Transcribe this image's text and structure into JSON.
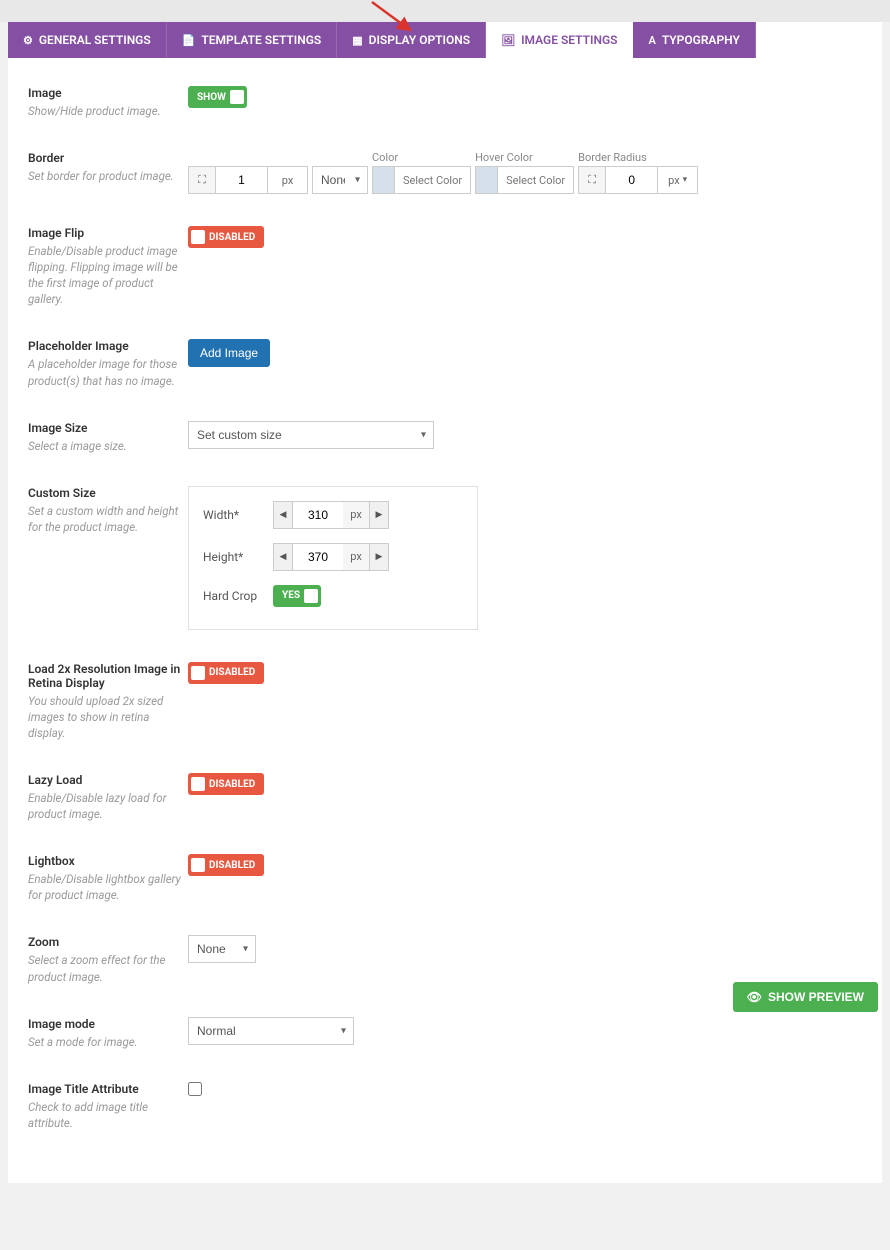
{
  "tabs": {
    "general": "GENERAL SETTINGS",
    "template": "TEMPLATE SETTINGS",
    "display": "DISPLAY OPTIONS",
    "image": "IMAGE SETTINGS",
    "typography": "TYPOGRAPHY"
  },
  "toggle": {
    "show": "SHOW",
    "disabled": "DISABLED",
    "yes": "YES"
  },
  "fields": {
    "image": {
      "label": "Image",
      "help": "Show/Hide product image."
    },
    "border": {
      "label": "Border",
      "help": "Set border for product image.",
      "width_val": "1",
      "width_unit": "px",
      "style": "None",
      "color_label": "Color",
      "color_btn": "Select Color",
      "hover_label": "Hover Color",
      "hover_btn": "Select Color",
      "radius_label": "Border Radius",
      "radius_val": "0",
      "radius_unit": "px"
    },
    "flip": {
      "label": "Image Flip",
      "help": "Enable/Disable product image flipping. Flipping image will be the first image of product gallery."
    },
    "placeholder": {
      "label": "Placeholder Image",
      "help": "A placeholder image for those product(s) that has no image.",
      "btn": "Add Image"
    },
    "size": {
      "label": "Image Size",
      "help": "Select a image size.",
      "value": "Set custom size"
    },
    "custom": {
      "label": "Custom Size",
      "help": "Set a custom width and height for the product image.",
      "width_label": "Width*",
      "width_val": "310",
      "height_label": "Height*",
      "height_val": "370",
      "unit": "px",
      "crop_label": "Hard Crop"
    },
    "retina": {
      "label": "Load 2x Resolution Image in Retina Display",
      "help": "You should upload 2x sized images to show in retina display."
    },
    "lazy": {
      "label": "Lazy Load",
      "help": "Enable/Disable lazy load for product image."
    },
    "lightbox": {
      "label": "Lightbox",
      "help": "Enable/Disable lightbox gallery for product image."
    },
    "zoom": {
      "label": "Zoom",
      "help": "Select a zoom effect for the product image.",
      "value": "None"
    },
    "mode": {
      "label": "Image mode",
      "help": "Set a mode for image.",
      "value": "Normal"
    },
    "title_attr": {
      "label": "Image Title Attribute",
      "help": "Check to add image title attribute."
    }
  },
  "preview_btn": "SHOW PREVIEW"
}
